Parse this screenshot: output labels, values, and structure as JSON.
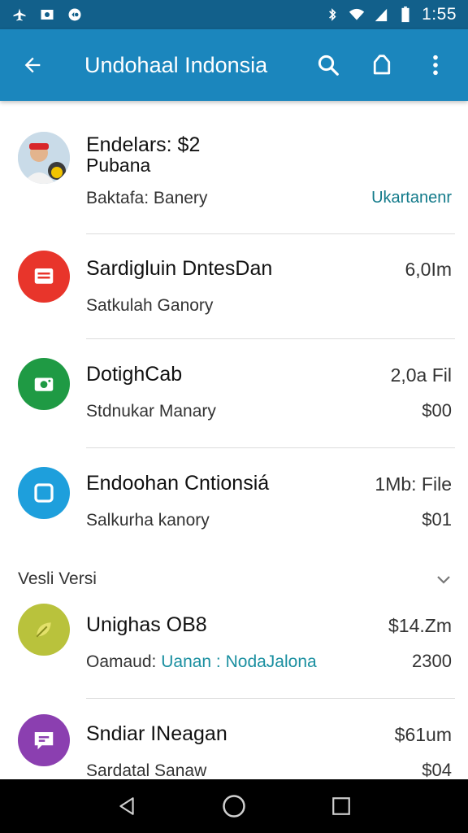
{
  "status_bar": {
    "time": "1:55",
    "left_icons": [
      "airplane-icon",
      "photo-icon",
      "vpn-icon"
    ],
    "right_icons": [
      "bluetooth-icon",
      "wifi-icon",
      "signal-icon",
      "battery-icon"
    ]
  },
  "app_bar": {
    "title": "Undohaal Indonsia",
    "background": "#1b86bd",
    "status_background": "#12608b"
  },
  "items": [
    {
      "avatar": "profile-photo",
      "avatar_color": "#e8e8e8",
      "title": "Endelars: $2",
      "title_line2": "Pubana",
      "subtitle": "Baktafa: Banery",
      "meta_top": "",
      "meta_bottom": "Ukartanenr",
      "meta_bottom_color": "#127a8a"
    },
    {
      "avatar": "message-icon",
      "avatar_color": "#e8352b",
      "title": "Sardigluin DntesDan",
      "subtitle": "Satkulah Ganory",
      "meta_top": "6,0Im",
      "meta_bottom": ""
    },
    {
      "avatar": "camera-icon",
      "avatar_color": "#1f9a44",
      "title": "DotighCab",
      "subtitle": "Stdnukar Manary",
      "meta_top": "2,0a Fil",
      "meta_bottom": "$00"
    },
    {
      "avatar": "square-icon",
      "avatar_color": "#1e9fdc",
      "title": "Endoohan Cntionsiá",
      "subtitle": "Salkurha kanory",
      "meta_top": "1Mb: File",
      "meta_bottom": "$01"
    }
  ],
  "section": {
    "label": "Vesli Versi"
  },
  "items_2": [
    {
      "avatar": "leaf-icon",
      "avatar_color": "#b9c23c",
      "title": "Unighas OB8",
      "subtitle_prefix": "Oamaud: ",
      "subtitle_highlight": "Uanan : NodaJalona",
      "subtitle_highlight_color": "#1a8fa0",
      "meta_top": "$14.Zm",
      "meta_bottom": "2300"
    },
    {
      "avatar": "chat-icon",
      "avatar_color": "#8b3fb0",
      "title": "Sndiar INeagan",
      "subtitle": "Sardatal Sanaw",
      "meta_top": "$61um",
      "meta_bottom": "$04"
    }
  ]
}
